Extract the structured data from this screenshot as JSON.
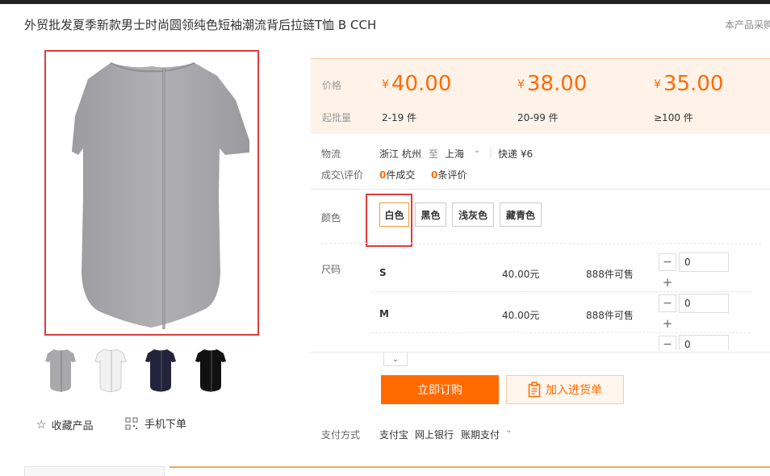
{
  "title": "外贸批发夏季新款男士时尚圆领纯色短袖潮流背后拉链T恤 B CCH",
  "side_note": "本产品采购",
  "gallery": {
    "thumbnails": [
      {
        "color": "#a9a9ab"
      },
      {
        "color": "#f1f1f1"
      },
      {
        "color": "#23233d"
      },
      {
        "color": "#111111"
      }
    ]
  },
  "favorite_label": "收藏产品",
  "mobile_label": "手机下单",
  "price_panel": {
    "price_label": "价格",
    "moq_label": "起批量",
    "currency": "¥",
    "tiers": [
      {
        "price": "40.00",
        "qty": "2-19 件"
      },
      {
        "price": "38.00",
        "qty": "20-99 件"
      },
      {
        "price": "35.00",
        "qty": "≥100 件"
      }
    ]
  },
  "logistics": {
    "label": "物流",
    "origin": "浙江 杭州",
    "to": "至",
    "destination": "上海",
    "shipping": "快递 ¥6"
  },
  "deals": {
    "label": "成交\\评价",
    "deal_count": "0",
    "deal_text": "件成交",
    "review_count": "0",
    "review_text": "条评价"
  },
  "color": {
    "label": "颜色",
    "options": [
      "白色",
      "黑色",
      "浅灰色",
      "藏青色"
    ]
  },
  "size": {
    "label": "尺码",
    "rows": [
      {
        "size": "S",
        "price": "40.00元",
        "stock": "888件可售",
        "qty": "0"
      },
      {
        "size": "M",
        "price": "40.00元",
        "stock": "888件可售",
        "qty": "0"
      },
      {
        "size": "",
        "price": "",
        "stock": "",
        "qty": "0"
      }
    ]
  },
  "stepper": {
    "minus": "−",
    "plus": "+"
  },
  "buttons": {
    "buy_now": "立即订购",
    "add_cart": "加入进货单"
  },
  "payment": {
    "label": "支付方式",
    "methods": [
      "支付宝",
      "网上银行",
      "账期支付"
    ]
  },
  "colors": {
    "accent": "#ff6a00",
    "highlight": "#e03c3c",
    "price_bg": "#fff3e9"
  }
}
